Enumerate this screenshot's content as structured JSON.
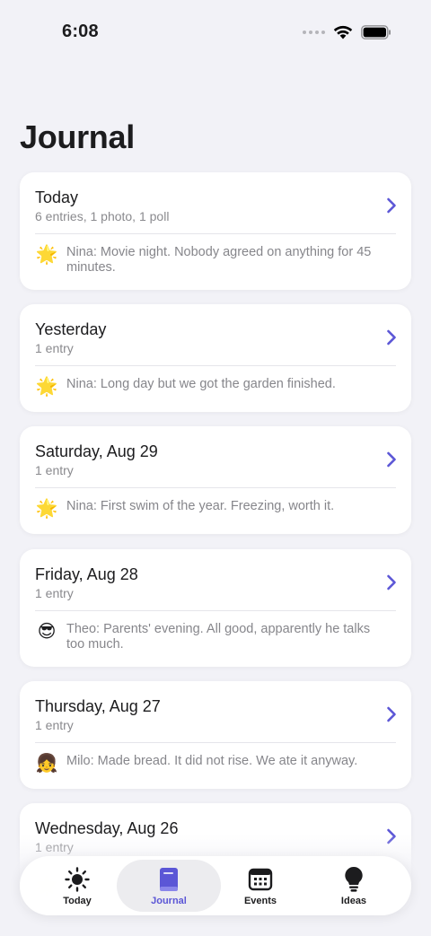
{
  "status": {
    "time": "6:08"
  },
  "page": {
    "title": "Journal"
  },
  "days": [
    {
      "title": "Today",
      "subtitle": "6 entries, 1 photo, 1 poll",
      "emoji": "🌟",
      "preview": "Nina: Movie night. Nobody agreed on anything for 45 minutes."
    },
    {
      "title": "Yesterday",
      "subtitle": "1 entry",
      "emoji": "🌟",
      "preview": "Nina: Long day but we got the garden finished."
    },
    {
      "title": "Saturday, Aug 29",
      "subtitle": "1 entry",
      "emoji": "🌟",
      "preview": "Nina: First swim of the year. Freezing, worth it."
    },
    {
      "title": "Friday, Aug 28",
      "subtitle": "1 entry",
      "emoji": "😎",
      "preview": "Theo: Parents' evening. All good, apparently he talks too much."
    },
    {
      "title": "Thursday, Aug 27",
      "subtitle": "1 entry",
      "emoji": "👧",
      "preview": "Milo: Made bread. It did not rise. We ate it anyway."
    },
    {
      "title": "Wednesday, Aug 26",
      "subtitle": "1 entry",
      "emoji": "🌟",
      "preview": ""
    }
  ],
  "tabs": [
    {
      "label": "Today",
      "icon": "sun-icon"
    },
    {
      "label": "Journal",
      "icon": "book-icon"
    },
    {
      "label": "Events",
      "icon": "calendar-icon"
    },
    {
      "label": "Ideas",
      "icon": "lightbulb-icon"
    }
  ],
  "colors": {
    "accent": "#5b56d6",
    "background": "#f2f2f7",
    "card": "#ffffff"
  }
}
